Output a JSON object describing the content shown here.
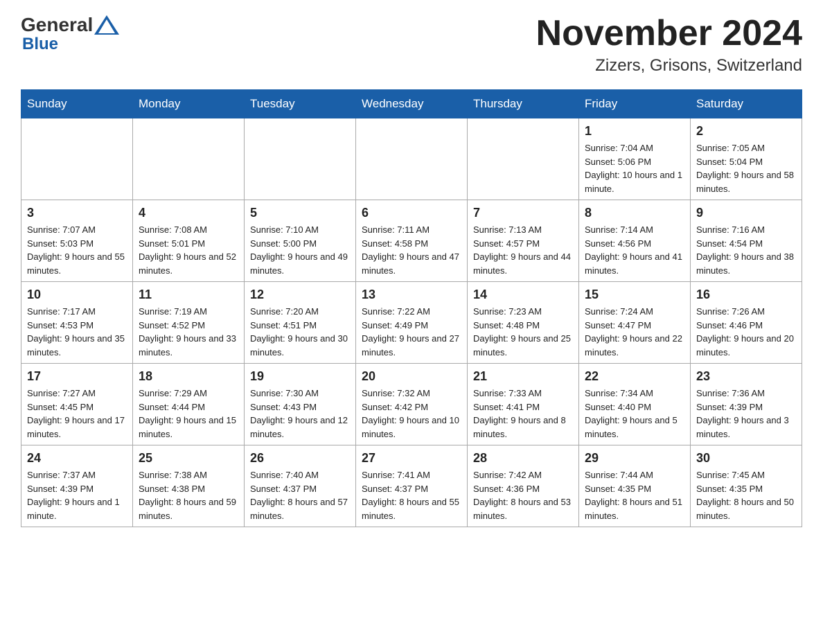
{
  "header": {
    "month_title": "November 2024",
    "location": "Zizers, Grisons, Switzerland",
    "logo_general": "General",
    "logo_blue": "Blue"
  },
  "days_of_week": [
    "Sunday",
    "Monday",
    "Tuesday",
    "Wednesday",
    "Thursday",
    "Friday",
    "Saturday"
  ],
  "weeks": [
    [
      {
        "day": "",
        "info": ""
      },
      {
        "day": "",
        "info": ""
      },
      {
        "day": "",
        "info": ""
      },
      {
        "day": "",
        "info": ""
      },
      {
        "day": "",
        "info": ""
      },
      {
        "day": "1",
        "info": "Sunrise: 7:04 AM\nSunset: 5:06 PM\nDaylight: 10 hours and 1 minute."
      },
      {
        "day": "2",
        "info": "Sunrise: 7:05 AM\nSunset: 5:04 PM\nDaylight: 9 hours and 58 minutes."
      }
    ],
    [
      {
        "day": "3",
        "info": "Sunrise: 7:07 AM\nSunset: 5:03 PM\nDaylight: 9 hours and 55 minutes."
      },
      {
        "day": "4",
        "info": "Sunrise: 7:08 AM\nSunset: 5:01 PM\nDaylight: 9 hours and 52 minutes."
      },
      {
        "day": "5",
        "info": "Sunrise: 7:10 AM\nSunset: 5:00 PM\nDaylight: 9 hours and 49 minutes."
      },
      {
        "day": "6",
        "info": "Sunrise: 7:11 AM\nSunset: 4:58 PM\nDaylight: 9 hours and 47 minutes."
      },
      {
        "day": "7",
        "info": "Sunrise: 7:13 AM\nSunset: 4:57 PM\nDaylight: 9 hours and 44 minutes."
      },
      {
        "day": "8",
        "info": "Sunrise: 7:14 AM\nSunset: 4:56 PM\nDaylight: 9 hours and 41 minutes."
      },
      {
        "day": "9",
        "info": "Sunrise: 7:16 AM\nSunset: 4:54 PM\nDaylight: 9 hours and 38 minutes."
      }
    ],
    [
      {
        "day": "10",
        "info": "Sunrise: 7:17 AM\nSunset: 4:53 PM\nDaylight: 9 hours and 35 minutes."
      },
      {
        "day": "11",
        "info": "Sunrise: 7:19 AM\nSunset: 4:52 PM\nDaylight: 9 hours and 33 minutes."
      },
      {
        "day": "12",
        "info": "Sunrise: 7:20 AM\nSunset: 4:51 PM\nDaylight: 9 hours and 30 minutes."
      },
      {
        "day": "13",
        "info": "Sunrise: 7:22 AM\nSunset: 4:49 PM\nDaylight: 9 hours and 27 minutes."
      },
      {
        "day": "14",
        "info": "Sunrise: 7:23 AM\nSunset: 4:48 PM\nDaylight: 9 hours and 25 minutes."
      },
      {
        "day": "15",
        "info": "Sunrise: 7:24 AM\nSunset: 4:47 PM\nDaylight: 9 hours and 22 minutes."
      },
      {
        "day": "16",
        "info": "Sunrise: 7:26 AM\nSunset: 4:46 PM\nDaylight: 9 hours and 20 minutes."
      }
    ],
    [
      {
        "day": "17",
        "info": "Sunrise: 7:27 AM\nSunset: 4:45 PM\nDaylight: 9 hours and 17 minutes."
      },
      {
        "day": "18",
        "info": "Sunrise: 7:29 AM\nSunset: 4:44 PM\nDaylight: 9 hours and 15 minutes."
      },
      {
        "day": "19",
        "info": "Sunrise: 7:30 AM\nSunset: 4:43 PM\nDaylight: 9 hours and 12 minutes."
      },
      {
        "day": "20",
        "info": "Sunrise: 7:32 AM\nSunset: 4:42 PM\nDaylight: 9 hours and 10 minutes."
      },
      {
        "day": "21",
        "info": "Sunrise: 7:33 AM\nSunset: 4:41 PM\nDaylight: 9 hours and 8 minutes."
      },
      {
        "day": "22",
        "info": "Sunrise: 7:34 AM\nSunset: 4:40 PM\nDaylight: 9 hours and 5 minutes."
      },
      {
        "day": "23",
        "info": "Sunrise: 7:36 AM\nSunset: 4:39 PM\nDaylight: 9 hours and 3 minutes."
      }
    ],
    [
      {
        "day": "24",
        "info": "Sunrise: 7:37 AM\nSunset: 4:39 PM\nDaylight: 9 hours and 1 minute."
      },
      {
        "day": "25",
        "info": "Sunrise: 7:38 AM\nSunset: 4:38 PM\nDaylight: 8 hours and 59 minutes."
      },
      {
        "day": "26",
        "info": "Sunrise: 7:40 AM\nSunset: 4:37 PM\nDaylight: 8 hours and 57 minutes."
      },
      {
        "day": "27",
        "info": "Sunrise: 7:41 AM\nSunset: 4:37 PM\nDaylight: 8 hours and 55 minutes."
      },
      {
        "day": "28",
        "info": "Sunrise: 7:42 AM\nSunset: 4:36 PM\nDaylight: 8 hours and 53 minutes."
      },
      {
        "day": "29",
        "info": "Sunrise: 7:44 AM\nSunset: 4:35 PM\nDaylight: 8 hours and 51 minutes."
      },
      {
        "day": "30",
        "info": "Sunrise: 7:45 AM\nSunset: 4:35 PM\nDaylight: 8 hours and 50 minutes."
      }
    ]
  ]
}
